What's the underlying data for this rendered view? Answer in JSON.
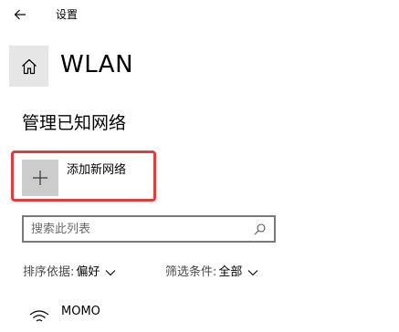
{
  "window": {
    "title": "设置",
    "back_icon": "back-arrow-icon"
  },
  "header": {
    "home_icon": "home-icon",
    "title": "WLAN"
  },
  "section": {
    "title": "管理已知网络"
  },
  "add_network": {
    "icon": "plus-icon",
    "label": "添加新网络",
    "highlight_color": "#d9403e"
  },
  "search": {
    "placeholder": "搜索此列表",
    "value": "",
    "icon": "search-icon"
  },
  "sort": {
    "label": "排序依据:",
    "value": "偏好"
  },
  "filter": {
    "label": "筛选条件:",
    "value": "全部"
  },
  "networks": [
    {
      "name": "MOMO",
      "icon": "wifi-icon"
    }
  ]
}
